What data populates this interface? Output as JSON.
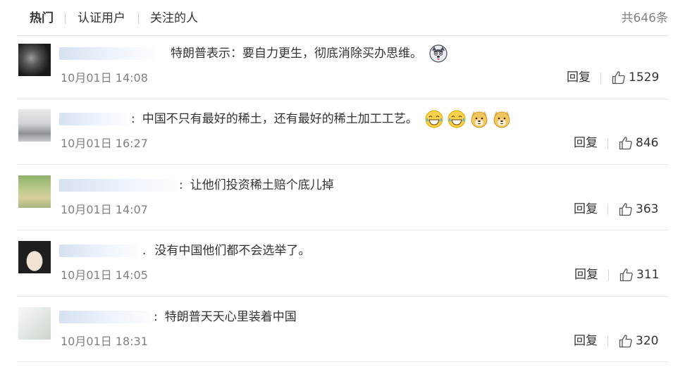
{
  "tabs": {
    "hot": "热门",
    "verified": "认证用户",
    "following": "关注的人"
  },
  "total": "共646条",
  "comments": [
    {
      "body": "特朗普表示：要自力更生，彻底消除买办思维。",
      "date": "10月01日 14:08",
      "reply": "回复",
      "likes": "1529",
      "emojis": [
        "husky-emoji"
      ]
    },
    {
      "body": "中国不只有最好的稀土，还有最好的稀土加工工艺。",
      "date": "10月01日 16:27",
      "reply": "回复",
      "likes": "846",
      "emojis": [
        "laugh-cry-emoji",
        "laugh-cry-emoji",
        "doge-emoji",
        "doge-emoji"
      ]
    },
    {
      "body": "让他们投资稀土赔个底儿掉",
      "date": "10月01日 14:07",
      "reply": "回复",
      "likes": "363",
      "emojis": []
    },
    {
      "body": "没有中国他们都不会选举了。",
      "date": "10月01日 14:05",
      "reply": "回复",
      "likes": "311",
      "emojis": []
    },
    {
      "body": "特朗普天天心里装着中国",
      "date": "10月01日 18:31",
      "reply": "回复",
      "likes": "320",
      "emojis": []
    }
  ],
  "colors": {
    "text": "#333333",
    "muted": "#808080",
    "divider": "#e6e6e6"
  }
}
